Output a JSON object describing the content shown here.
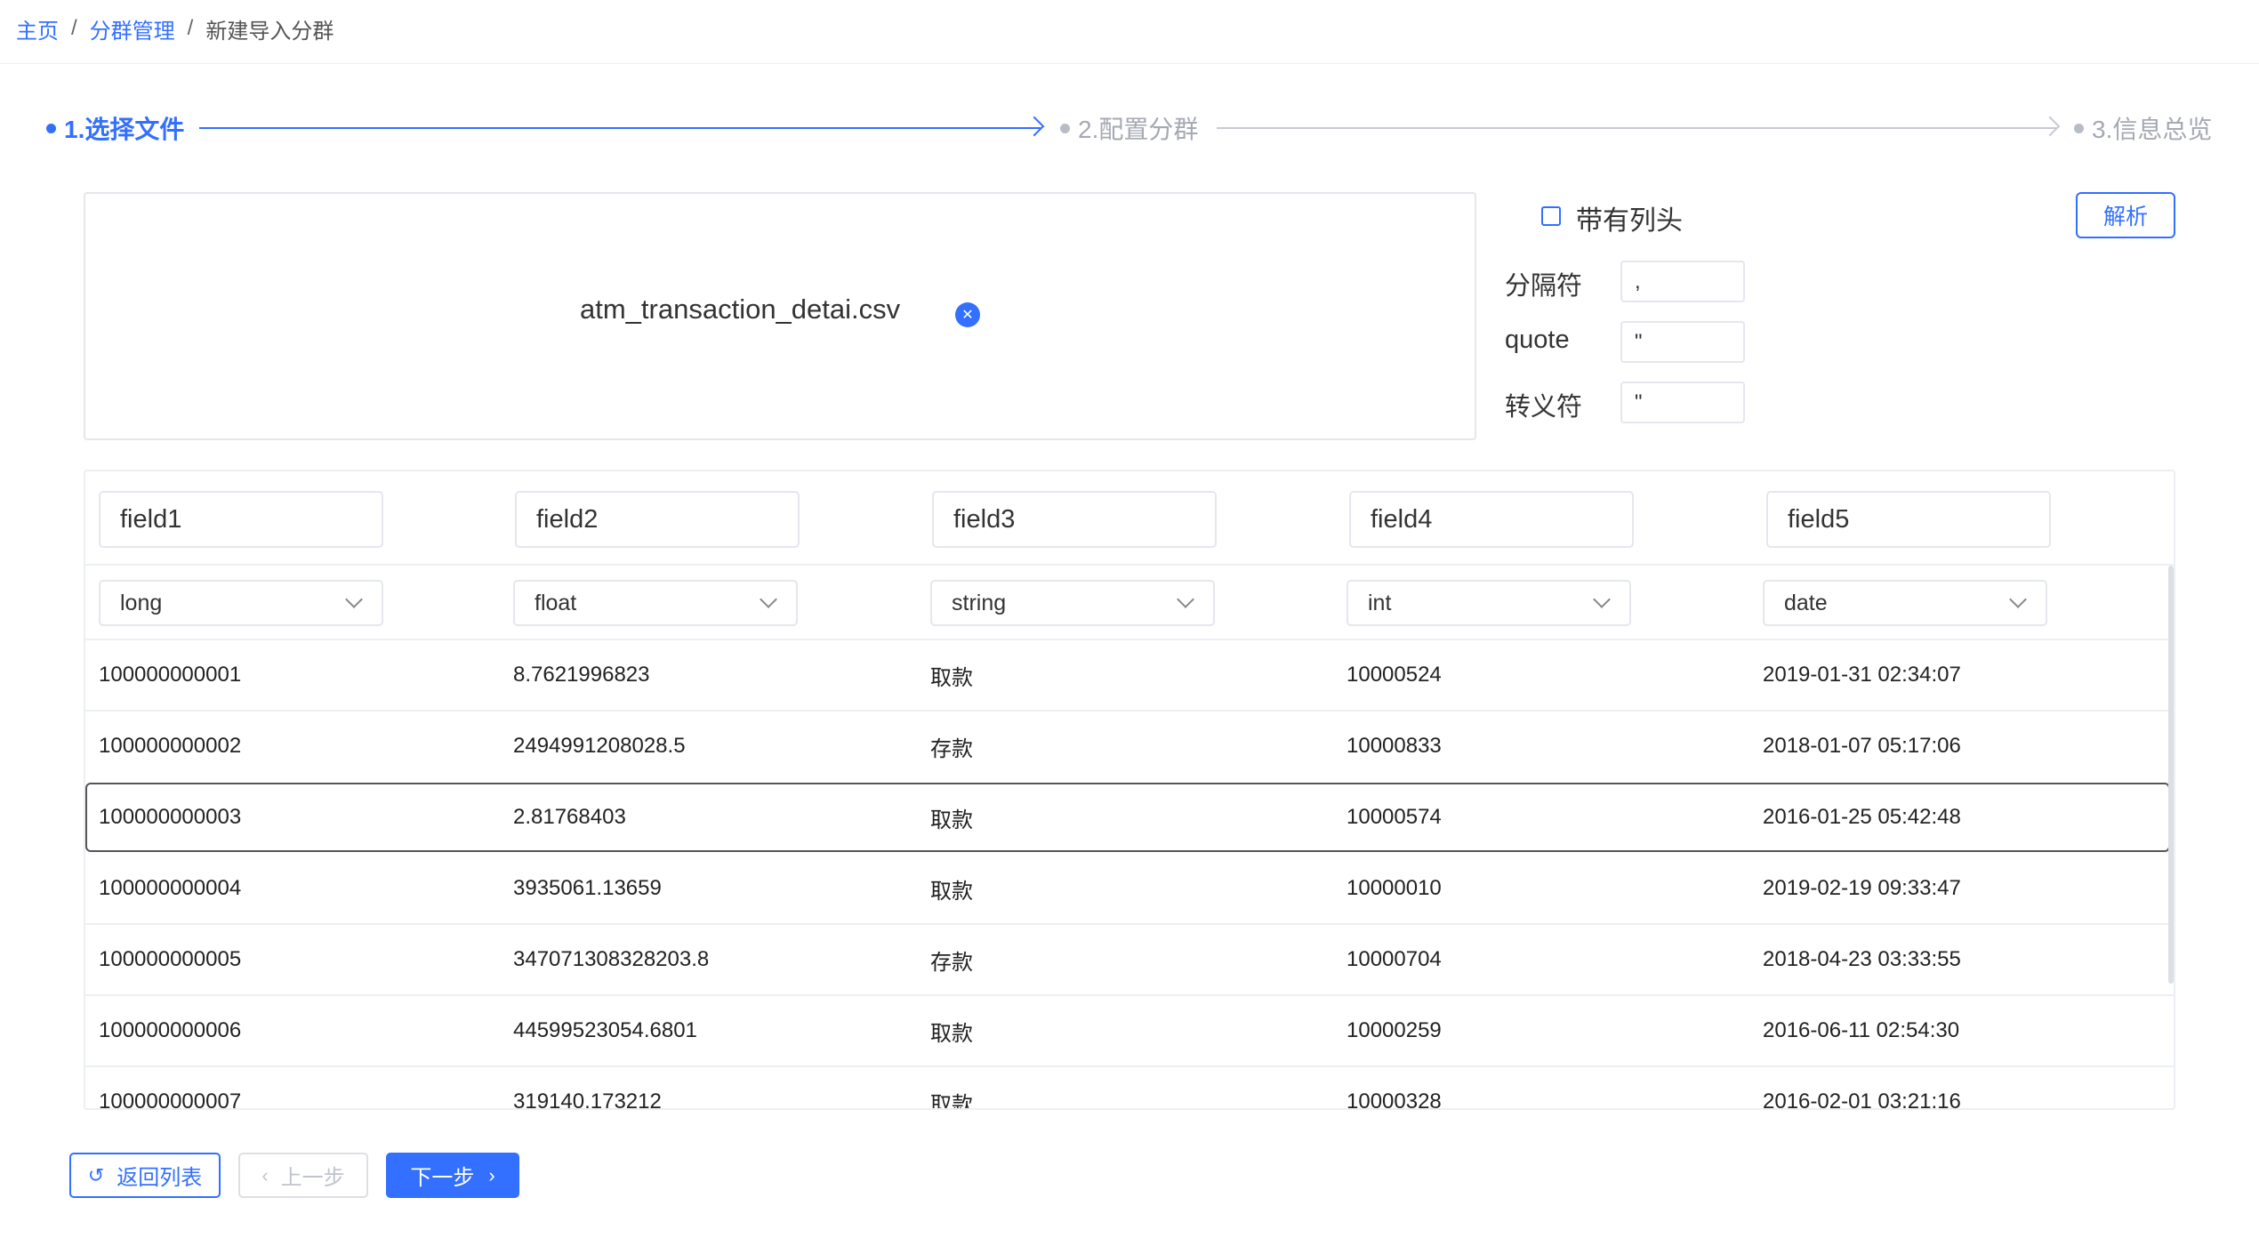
{
  "breadcrumb": {
    "home": "主页",
    "section": "分群管理",
    "current": "新建导入分群",
    "separator": "/"
  },
  "steps": [
    {
      "label": "1.选择文件",
      "state": "active"
    },
    {
      "label": "2.配置分群",
      "state": "inactive"
    },
    {
      "label": "3.信息总览",
      "state": "inactive"
    }
  ],
  "upload": {
    "file_name": "atm_transaction_detai.csv",
    "remove_icon": "close-circle-icon",
    "remove_glyph": "✕"
  },
  "options": {
    "header_checkbox_label": "带有列头",
    "header_checked": false,
    "parse_label": "解析",
    "delimiter_label": "分隔符",
    "delimiter_value": ",",
    "quote_label": "quote",
    "quote_value": "\"",
    "escape_label": "转义符",
    "escape_value": "\""
  },
  "table": {
    "fields": [
      "field1",
      "field2",
      "field3",
      "field4",
      "field5"
    ],
    "types": [
      "long",
      "float",
      "string",
      "int",
      "date"
    ],
    "rows": [
      [
        "100000000001",
        "8.7621996823",
        "取款",
        "10000524",
        "2019-01-31 02:34:07"
      ],
      [
        "100000000002",
        "2494991208028.5",
        "存款",
        "10000833",
        "2018-01-07 05:17:06"
      ],
      [
        "100000000003",
        "2.81768403",
        "取款",
        "10000574",
        "2016-01-25 05:42:48"
      ],
      [
        "100000000004",
        "3935061.13659",
        "取款",
        "10000010",
        "2019-02-19 09:33:47"
      ],
      [
        "100000000005",
        "347071308328203.8",
        "存款",
        "10000704",
        "2018-04-23 03:33:55"
      ],
      [
        "100000000006",
        "44599523054.6801",
        "取款",
        "10000259",
        "2016-06-11 02:54:30"
      ],
      [
        "100000000007",
        "319140.173212",
        "取款",
        "10000328",
        "2016-02-01 03:21:16"
      ]
    ],
    "selected_row": 2
  },
  "footer": {
    "back_label": "返回列表",
    "back_icon": "return-icon",
    "back_glyph": "↺",
    "prev_label": "上一步",
    "prev_icon": "chevron-left-icon",
    "prev_glyph": "‹",
    "next_label": "下一步",
    "next_icon": "chevron-right-icon",
    "next_glyph": "›"
  },
  "colors": {
    "accent": "#3370ff",
    "muted": "#a5a9b3",
    "border": "#e4e7ed"
  }
}
